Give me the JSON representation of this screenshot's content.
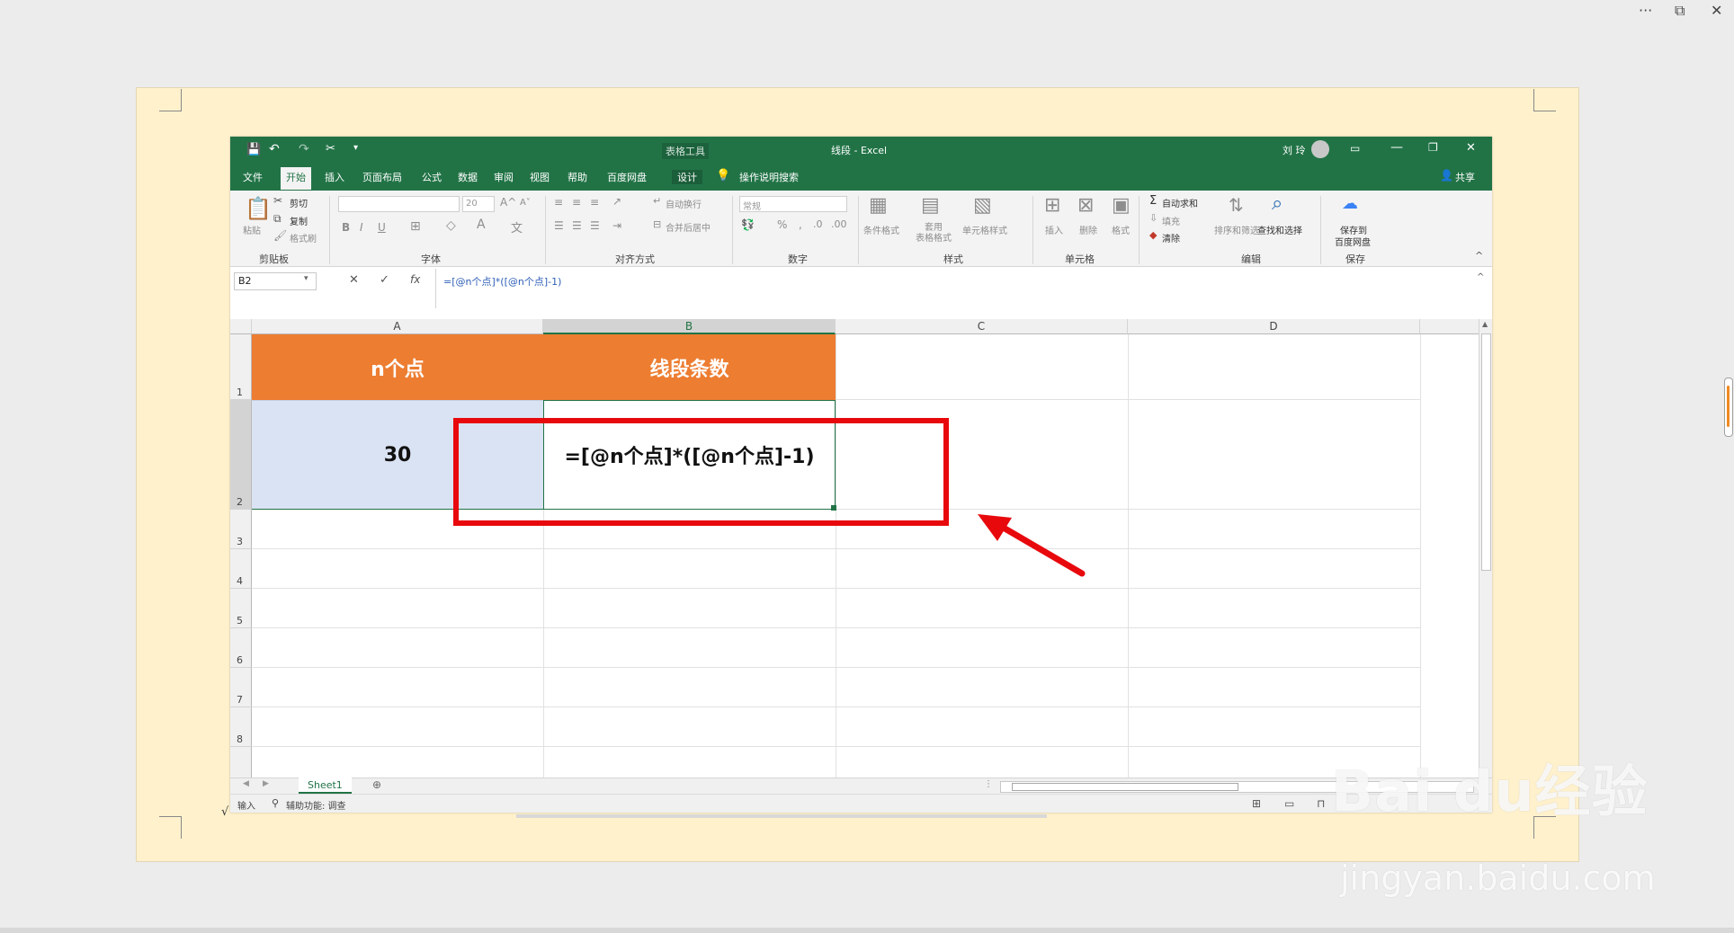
{
  "viewer": {
    "more_label": "···",
    "restore_label": "⧉",
    "close_label": "✕"
  },
  "titlebar": {
    "table_tools": "表格工具",
    "doc_title": "线段 - Excel",
    "user_name": "刘 玲"
  },
  "tabs": [
    {
      "label": "文件"
    },
    {
      "label": "开始"
    },
    {
      "label": "插入"
    },
    {
      "label": "页面布局"
    },
    {
      "label": "公式"
    },
    {
      "label": "数据"
    },
    {
      "label": "审阅"
    },
    {
      "label": "视图"
    },
    {
      "label": "帮助"
    },
    {
      "label": "百度网盘"
    },
    {
      "label": "设计"
    }
  ],
  "tell_me": "操作说明搜索",
  "share": "共享",
  "ribbon": {
    "clipboard": {
      "paste": "粘贴",
      "cut": "剪切",
      "copy": "复制",
      "format_painter": "格式刷",
      "label": "剪贴板"
    },
    "font": {
      "size": "20",
      "bold": "B",
      "italic": "I",
      "underline": "U",
      "label": "字体"
    },
    "alignment": {
      "wrap": "自动换行",
      "merge": "合并后居中",
      "label": "对齐方式"
    },
    "number": {
      "format": "常规",
      "label": "数字"
    },
    "styles": {
      "conditional": "条件格式",
      "as_table": "套用\n表格格式",
      "cell_styles": "单元格样式",
      "label": "样式"
    },
    "cells": {
      "insert": "插入",
      "delete": "删除",
      "format": "格式",
      "label": "单元格"
    },
    "editing": {
      "autosum": "自动求和",
      "fill": "填充",
      "clear": "清除",
      "sort": "排序和筛选",
      "find": "查找和选择",
      "label": "编辑"
    },
    "save": {
      "save_to": "保存到",
      "baidu": "百度网盘",
      "label": "保存"
    }
  },
  "formula_bar": {
    "name_box": "B2",
    "cancel": "✕",
    "enter": "✓",
    "fx": "fx",
    "formula": "=[@n个点]*([@n个点]-1)"
  },
  "columns": [
    "A",
    "B",
    "C",
    "D"
  ],
  "rows": [
    "1",
    "2",
    "3",
    "4",
    "5",
    "6",
    "7",
    "8"
  ],
  "cells": {
    "A1": "n个点",
    "B1": "线段条数",
    "A2": "30",
    "B2": "=[@n个点]*([@n个点]-1)"
  },
  "sheet_tab": "Sheet1",
  "status": {
    "mode": "输入",
    "accessibility": "辅助功能: 调查"
  },
  "watermark": {
    "brand": "Bai du经验",
    "url": "jingyan.baidu.com"
  },
  "colors": {
    "excel_green": "#217346",
    "header_orange": "#ed7d31",
    "selection_blue": "#dae3f3",
    "annotation_red": "#e8090d"
  }
}
